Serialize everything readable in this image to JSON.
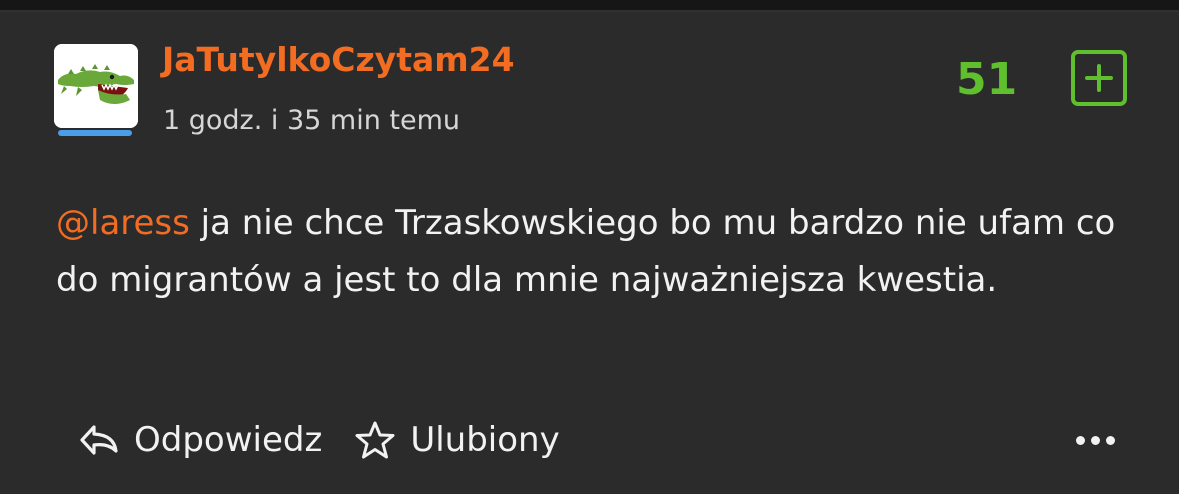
{
  "post": {
    "author": "JaTutylkoCzytam24",
    "time": "1 godz. i 35 min temu",
    "vote_count": "51",
    "mention": "@laress",
    "body": " ja nie chce Trzaskowskiego bo mu bardzo nie ufam co do migrantów a jest to dla mnie najważniejsza kwestia."
  },
  "actions": {
    "reply": "Odpowiedz",
    "favorite": "Ulubiony"
  },
  "icons": {
    "avatar": "crocodile-avatar-icon",
    "plus": "plus-icon",
    "reply": "reply-arrow-icon",
    "favorite": "star-outline-icon",
    "more": "more-dots-icon"
  },
  "colors": {
    "background": "#2b2b2b",
    "username": "#f26c22",
    "mention": "#f26c22",
    "vote": "#5fbf2d",
    "text": "#f2f2f2",
    "avatar_bar": "#4a9ee8"
  }
}
